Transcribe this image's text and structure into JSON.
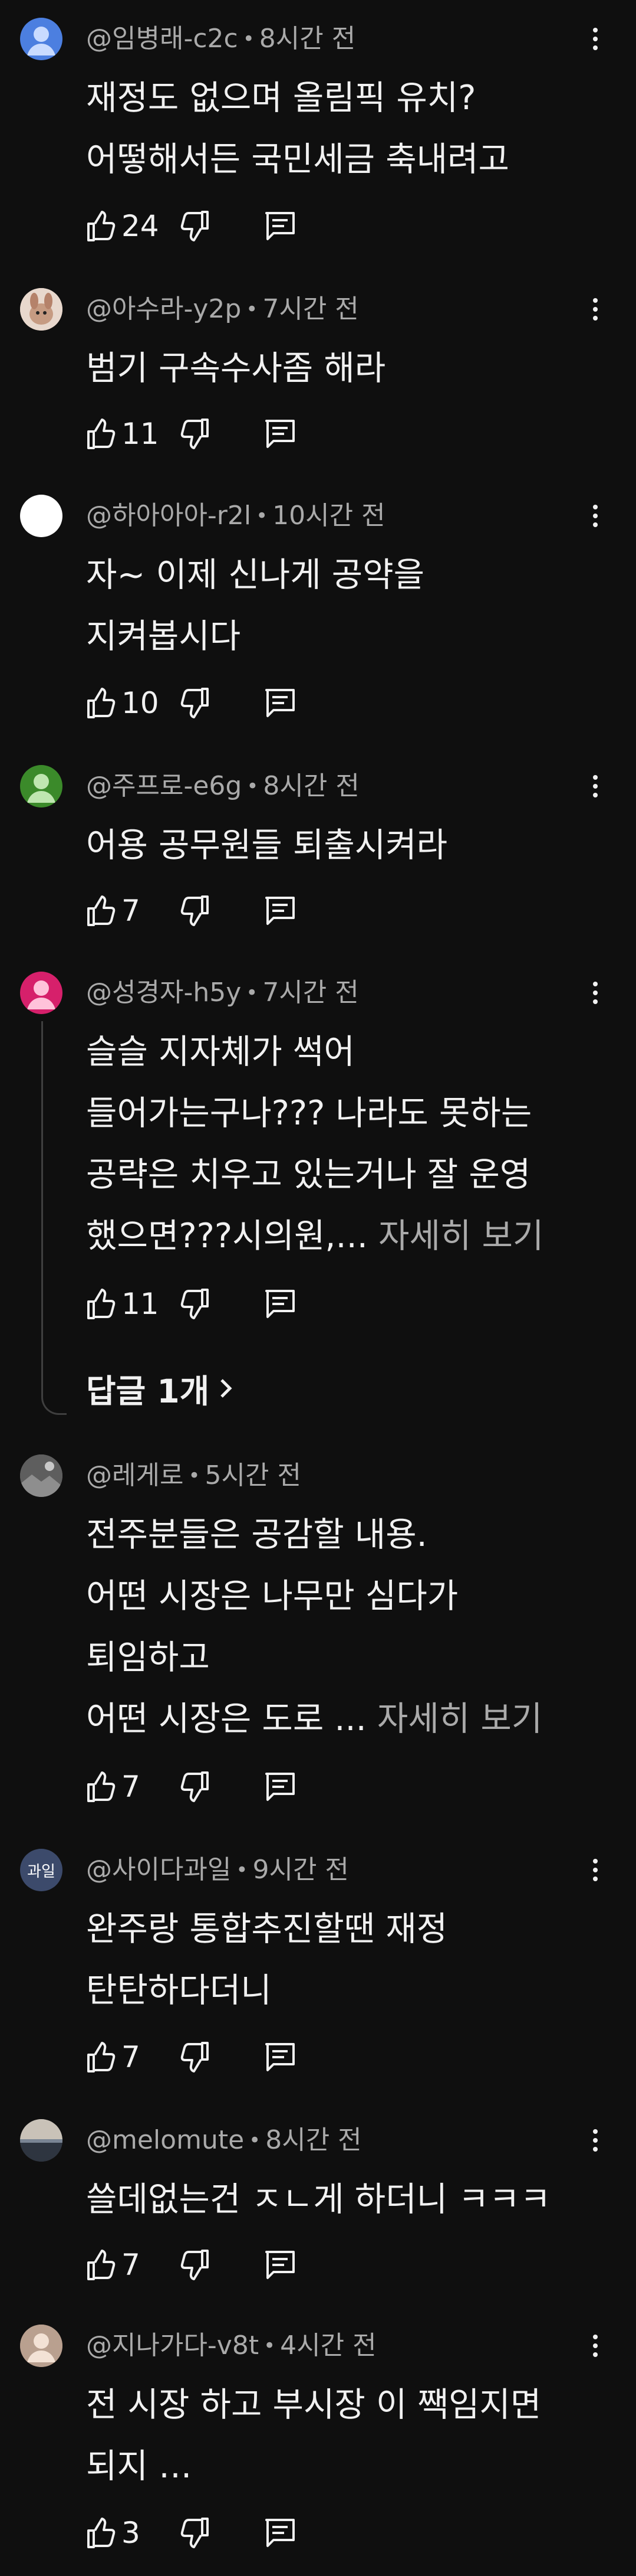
{
  "comments": [
    {
      "handle": "@임병래-c2c",
      "time": "8시간 전",
      "lines": [
        "재정도 없으며 올림픽 유치?",
        "어떻해서든 국민세금 축내려고"
      ],
      "likes": "24",
      "avatar": {
        "color": "#4c7fe0",
        "icon": "person-icon"
      }
    },
    {
      "handle": "@아수라-y2p",
      "time": "7시간 전",
      "lines": [
        "범기 구속수사좀 해라"
      ],
      "likes": "11",
      "avatar": {
        "color": "#d9c3b6",
        "icon": "pet-photo-icon"
      }
    },
    {
      "handle": "@하아아아-r2l",
      "time": "10시간 전",
      "lines": [
        "자~ 이제 신나게 공약을",
        "지켜봅시다"
      ],
      "likes": "10",
      "avatar": {
        "color": "#ffffff",
        "icon": "blank-avatar-icon"
      }
    },
    {
      "handle": "@주프로-e6g",
      "time": "8시간 전",
      "lines": [
        "어용 공무원들 퇴출시켜라"
      ],
      "likes": "7",
      "avatar": {
        "color": "#3b8a2a",
        "icon": "person-icon"
      }
    },
    {
      "handle": "@성경자-h5y",
      "time": "7시간 전",
      "lines": [
        "슬슬 지자체가 썩어",
        "들어가는구나???  나라도 못하는",
        "공략은 치우고 있는거나 잘 운영",
        "했으면???시의원,..."
      ],
      "more_label": "자세히 보기",
      "likes": "11",
      "replies_label": "답글 1개",
      "avatar": {
        "color": "#d6206b",
        "icon": "person-icon"
      }
    },
    {
      "handle": "@레게로",
      "time": "5시간 전",
      "lines": [
        "전주분들은 공감할 내용.",
        "어떤 시장은 나무만 심다가",
        "퇴임하고",
        "어떤 시장은 도로 ..."
      ],
      "more_label": "자세히 보기",
      "likes": "7",
      "avatar": {
        "color": "#6d6d6d",
        "icon": "photo-avatar-icon"
      }
    },
    {
      "handle": "@사이다과일",
      "time": "9시간 전",
      "lines": [
        "완주랑 통합추진할땐 재정",
        "탄탄하다더니"
      ],
      "likes": "7",
      "avatar": {
        "color": "#3c4a6b",
        "text": "과일"
      }
    },
    {
      "handle": "@melomute",
      "time": "8시간 전",
      "lines": [
        "쓸데없는건 ㅈㄴ게 하더니 ㅋㅋㅋ"
      ],
      "likes": "7",
      "avatar": {
        "color": "#4a4a4a",
        "icon": "landscape-avatar-icon"
      }
    },
    {
      "handle": "@지나가다-v8t",
      "time": "4시간 전",
      "lines": [
        "전 시장 하고 부시장 이  짹임지면",
        "되지 ‥."
      ],
      "likes": "3",
      "avatar": {
        "color": "#8a6a5a",
        "icon": "person-icon"
      }
    }
  ]
}
